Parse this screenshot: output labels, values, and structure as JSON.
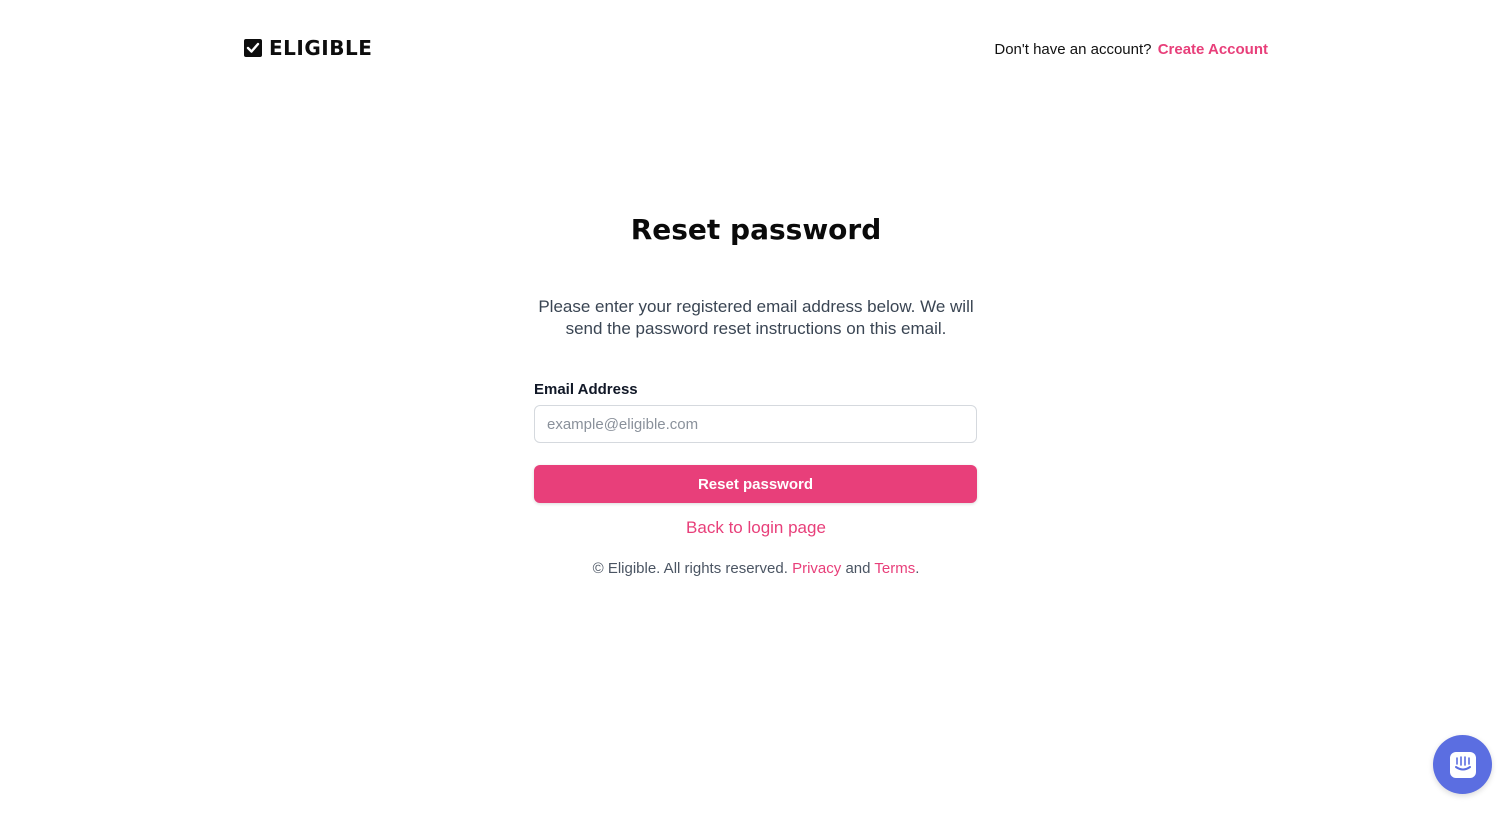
{
  "brand": {
    "name": "ELIGIBLE",
    "accent_color": "#e83f7a",
    "logo_icon": "checkbox-icon"
  },
  "header": {
    "prompt_text": "Don't have an account?",
    "create_account_label": "Create Account"
  },
  "main": {
    "title": "Reset password",
    "description": "Please enter your registered email address below. We will send the password reset instructions on this email.",
    "email_label": "Email Address",
    "email_value": "",
    "email_placeholder": "example@eligible.com",
    "submit_label": "Reset password",
    "back_link_label": "Back to login page"
  },
  "footer": {
    "copyright": "© Eligible. All rights reserved.",
    "privacy_label": "Privacy",
    "and_text": "and",
    "terms_label": "Terms",
    "period": "."
  },
  "chat_widget": {
    "icon": "chat-icon",
    "color": "#5b6ee1"
  }
}
